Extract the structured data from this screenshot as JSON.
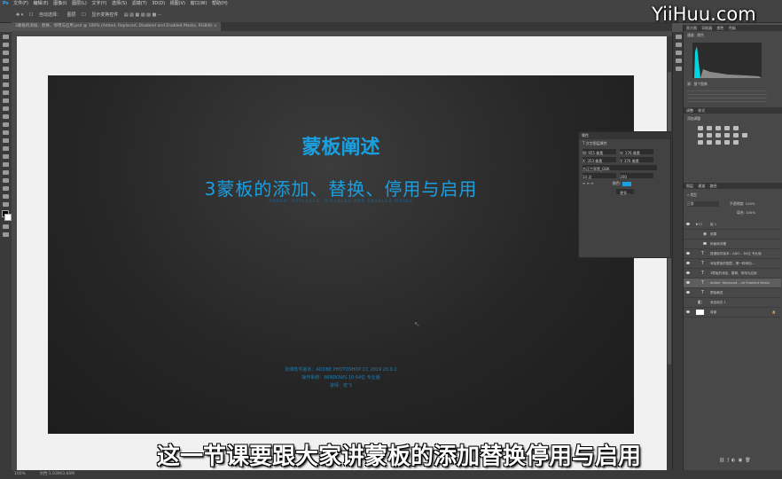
{
  "menubar": {
    "items": [
      "文件(F)",
      "编辑(E)",
      "图像(I)",
      "图层(L)",
      "文字(Y)",
      "选择(S)",
      "滤镜(T)",
      "3D(D)",
      "视图(V)",
      "窗口(W)",
      "帮助(H)"
    ]
  },
  "options": {
    "auto_select": "自动选择：",
    "target": "图层",
    "show_transform": "显示变换控件"
  },
  "document": {
    "tab_title": "3蒙板的添加、替换、停用与启用.psd @ 100% (Added, Replaced, Disabled and Enabled Masks, RGB/8)"
  },
  "artboard": {
    "title": "蒙板阐述",
    "subtitle": "3蒙板的添加、替换、停用与启用",
    "english": "ADDED, REPLACED, DISABLED AND ENABLED MASKS",
    "info_software": "授课软件版本：ADOBE PHOTOSHOP CC 2019 20.0.2",
    "info_os": "操作系统：WINDOWS 10 64位 专业版",
    "info_author": "讲师：宏飞",
    "accent_color": "#1a9fe0"
  },
  "caption": "这一节课要跟大家讲蒙板的添加替换停用与启用",
  "watermark": "YiiHuu.com",
  "statusbar": {
    "zoom": "100%",
    "doc": "文档:1.03M/3.66M"
  },
  "properties": {
    "tab": "属性",
    "section": "文字图层属性",
    "w": "W: 955 像素",
    "h": "H: 176 像素",
    "x": "X: 353 像素",
    "y": "Y: 376 像素",
    "font": "方正兰亭黑_GBK",
    "size": "14 点",
    "leading": "200",
    "color_label": "颜色:",
    "more": "更多..."
  },
  "right": {
    "histogram_tabs": [
      "直方图",
      "导航器",
      "颜色",
      "色板"
    ],
    "channel": "通道：颜色",
    "source": "源：整个图像",
    "adjust_tabs": [
      "调整",
      "样式"
    ],
    "add_adjust": "添加调整",
    "layer_tabs": [
      "图层",
      "通道",
      "路径"
    ],
    "kind": "类型",
    "blend": "正常",
    "opacity": "不透明度: 100%",
    "fill": "填充: 100%",
    "layers": [
      {
        "name": "组 1",
        "type": "group",
        "selected": false
      },
      {
        "name": "效果",
        "type": "fx",
        "selected": false
      },
      {
        "name": "斜面和浮雕",
        "type": "fx",
        "selected": false
      },
      {
        "name": "授课软件版本：ADO... 64位 专业版",
        "type": "text",
        "selected": false
      },
      {
        "name": "添加蒙板的图层，第一种添加...",
        "type": "text",
        "selected": false
      },
      {
        "name": "3蒙板的添加、替换、停用与启用",
        "type": "text",
        "selected": false
      },
      {
        "name": "Added, Replaced,...nd Enabled Masks",
        "type": "text",
        "selected": true
      },
      {
        "name": "蒙板阐述",
        "type": "text",
        "selected": false
      },
      {
        "name": "渐变填充 1",
        "type": "fill",
        "selected": false
      },
      {
        "name": "背景",
        "type": "bg",
        "selected": false
      }
    ]
  }
}
